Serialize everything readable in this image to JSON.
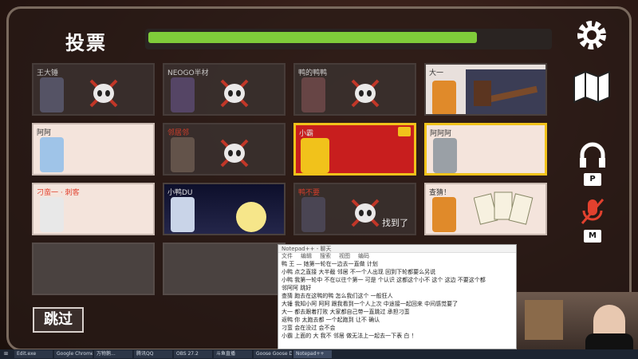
{
  "header": {
    "title": "投票",
    "timer_progress": 0.82
  },
  "colors": {
    "timer": "#7fcc3a",
    "self_border": "#f1c21b",
    "dead_cross": "#d23a2a",
    "name_red": "#e2412e"
  },
  "players": [
    {
      "name": "王大锤",
      "status": "dead",
      "name_color": "default"
    },
    {
      "name": "NEOGO半材",
      "status": "dead",
      "name_color": "default"
    },
    {
      "name": "鸭的鸭鸭",
      "status": "dead",
      "name_color": "default"
    },
    {
      "name": "大一",
      "status": "alive",
      "name_color": "default"
    },
    {
      "name": "阿阿",
      "status": "alive",
      "name_color": "default"
    },
    {
      "name": "邻居邻",
      "status": "dead",
      "name_color": "red"
    },
    {
      "name": "小霸",
      "status": "self",
      "name_color": "default"
    },
    {
      "name": "阿阿阿",
      "status": "alive",
      "name_color": "default"
    },
    {
      "name": "刁蛮一 · 刺客",
      "status": "alive",
      "name_color": "red"
    },
    {
      "name": "小鸭DU",
      "status": "alive",
      "name_color": "default"
    },
    {
      "name": "鸭不要",
      "status": "dead",
      "name_color": "red",
      "tag": "找到了"
    },
    {
      "name": "查猜！",
      "status": "alive",
      "name_color": "default"
    }
  ],
  "skip_button": {
    "label": "跳过"
  },
  "key_hints": {
    "mic": "P",
    "mute": "M"
  },
  "icons": [
    "gear-icon",
    "map-icon",
    "headphones-icon",
    "mic-muted-icon",
    "skull-icon"
  ],
  "chat_window": {
    "title": "Notepad++ - 聊天",
    "menu": [
      "文件",
      "编辑",
      "搜索",
      "视图",
      "编码"
    ],
    "lines": [
      "鸭 王 — 她第一轮在一边去一直做 计划",
      "小鸭 点之直接 大半截 邻居 不一个人出现 回到下轮都要么另说",
      "小鸭 我第一轮中 不在以往个第一 可是 个认识 这都这个小不 这个 这边 不要这个都",
      "邻阿阿 跳好",
      "查猜 跑去在这鸭的鸭 怎么我们这个  一般狂人",
      "大锤 我知小阿 阿阿 跟我看到一个人上次 中途接一起回来 中间感觉要了",
      "大一 都去跟着打败 大家都自己带一直跳过 承担刁蛮",
      "返鸭 你 太跑去都 一个起跑到 让不 确认",
      "刁蛮 会在没过 会不会",
      "小霸 上面的 大 我不 邻居 做无法上一起去一下表 白 ！"
    ]
  },
  "taskbar": {
    "items": [
      "Edit.exe",
      "Google Chrome",
      "万物鹅...",
      "腾讯QQ",
      "OBS 27.2",
      "斗鱼直播",
      "Goose Goose Duck",
      "Notepad++"
    ]
  }
}
